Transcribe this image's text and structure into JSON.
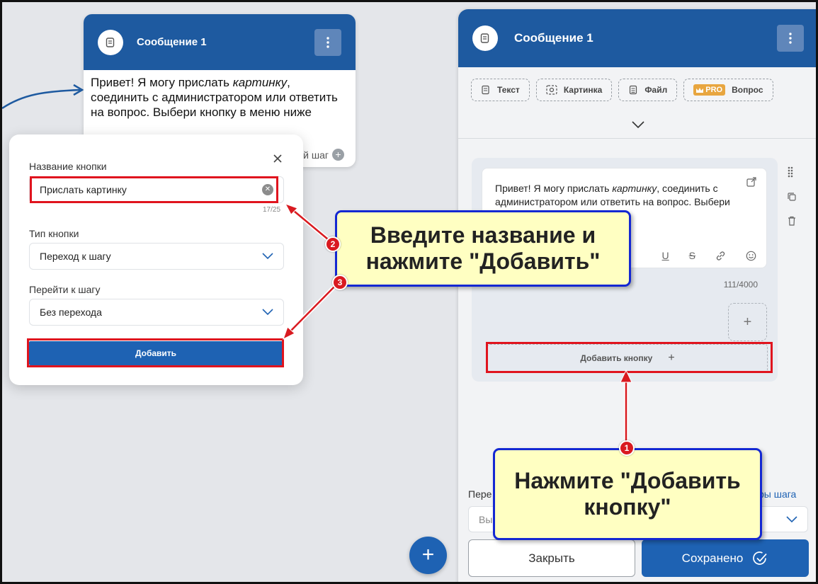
{
  "canvas_node": {
    "title": "Сообщение 1",
    "text_parts": [
      "Привет! Я могу прислать ",
      "картинку",
      ", соединить с администратором или ответить на вопрос. Выбери кнопку в меню ниже"
    ],
    "next_step_label": "щий шаг"
  },
  "modal": {
    "button_name_label": "Название кнопки",
    "button_name_value": "Прислать картинку",
    "button_name_counter": "17/25",
    "button_type_label": "Тип кнопки",
    "button_type_value": "Переход к шагу",
    "goto_step_label": "Перейти к шагу",
    "goto_step_value": "Без перехода",
    "add_button_label": "Добавить"
  },
  "panel": {
    "title": "Сообщение 1",
    "tools": [
      {
        "label": "Текст",
        "icon": "text-icon"
      },
      {
        "label": "Картинка",
        "icon": "image-icon"
      },
      {
        "label": "Файл",
        "icon": "file-icon"
      },
      {
        "label": "Вопрос",
        "icon": "question-icon",
        "badge": "PRO"
      }
    ],
    "message_text_parts": [
      "Привет! Я могу прислать ",
      "картинку",
      ", соединить с администратором или ответить на вопрос. Выбери кнопку в меню ниже"
    ],
    "char_counter": "111/4000",
    "add_button_label": "Добавить кнопку",
    "next_label": "Пере",
    "next_link": "ры шага",
    "next_select_placeholder": "Вы",
    "close_label": "Закрыть",
    "saved_label": "Сохранено"
  },
  "callouts": {
    "step2_text": "Введите название и нажмите \"Добавить\"",
    "step1_text": "Нажмите \"Добавить кнопку\"",
    "badge1": "1",
    "badge2": "2",
    "badge3": "3"
  },
  "colors": {
    "header_blue": "#1e5aa0",
    "primary_blue": "#1e62b3",
    "highlight_red": "#e0141e",
    "callout_fill": "#ffffc2",
    "callout_border": "#1428d2",
    "pro_badge": "#e8a640"
  }
}
